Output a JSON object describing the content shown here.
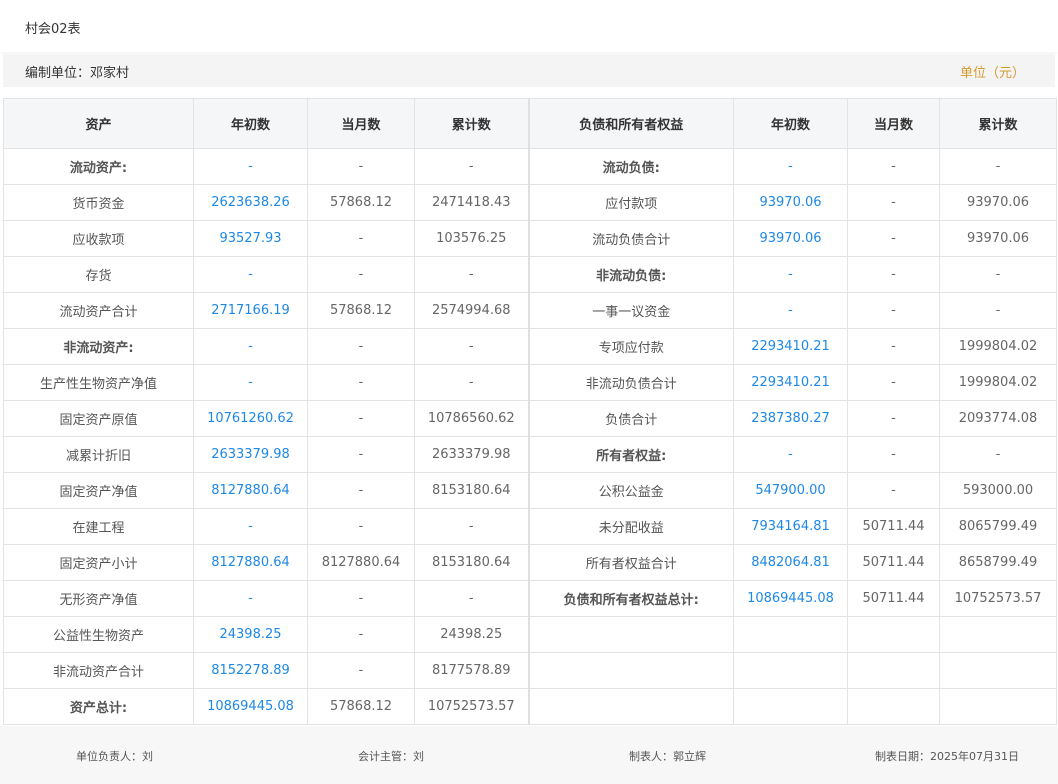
{
  "header": {
    "form_code": "村会02表",
    "compile_unit": "编制单位：邓家村",
    "currency_unit": "单位（元）"
  },
  "columns": {
    "assets": "资产",
    "assets_begin": "年初数",
    "assets_month": "当月数",
    "assets_cumulative": "累计数",
    "liabilities": "负债和所有者权益",
    "liab_begin": "年初数",
    "liab_month": "当月数",
    "liab_cumulative": "累计数"
  },
  "rows": [
    {
      "a": "流动资产:",
      "ab": "-",
      "am": "-",
      "ac": "-",
      "l": "流动负债:",
      "lb": "-",
      "lm": "-",
      "lc": "-"
    },
    {
      "a": "货币资金",
      "ab": "2623638.26",
      "am": "57868.12",
      "ac": "2471418.43",
      "l": "应付款项",
      "lb": "93970.06",
      "lm": "-",
      "lc": "93970.06"
    },
    {
      "a": "应收款项",
      "ab": "93527.93",
      "am": "-",
      "ac": "103576.25",
      "l": "流动负债合计",
      "lb": "93970.06",
      "lm": "-",
      "lc": "93970.06"
    },
    {
      "a": "存货",
      "ab": "-",
      "am": "-",
      "ac": "-",
      "l": "非流动负债:",
      "lb": "-",
      "lm": "-",
      "lc": "-"
    },
    {
      "a": "流动资产合计",
      "ab": "2717166.19",
      "am": "57868.12",
      "ac": "2574994.68",
      "l": "一事一议资金",
      "lb": "-",
      "lm": "-",
      "lc": "-"
    },
    {
      "a": "非流动资产:",
      "ab": "-",
      "am": "-",
      "ac": "-",
      "l": "专项应付款",
      "lb": "2293410.21",
      "lm": "-",
      "lc": "1999804.02"
    },
    {
      "a": "生产性生物资产净值",
      "ab": "-",
      "am": "-",
      "ac": "-",
      "l": "非流动负债合计",
      "lb": "2293410.21",
      "lm": "-",
      "lc": "1999804.02"
    },
    {
      "a": "固定资产原值",
      "ab": "10761260.62",
      "am": "-",
      "ac": "10786560.62",
      "l": "负债合计",
      "lb": "2387380.27",
      "lm": "-",
      "lc": "2093774.08"
    },
    {
      "a": "减累计折旧",
      "ab": "2633379.98",
      "am": "-",
      "ac": "2633379.98",
      "l": "所有者权益:",
      "lb": "-",
      "lm": "-",
      "lc": "-"
    },
    {
      "a": "固定资产净值",
      "ab": "8127880.64",
      "am": "-",
      "ac": "8153180.64",
      "l": "公积公益金",
      "lb": "547900.00",
      "lm": "-",
      "lc": "593000.00"
    },
    {
      "a": "在建工程",
      "ab": "-",
      "am": "-",
      "ac": "-",
      "l": "未分配收益",
      "lb": "7934164.81",
      "lm": "50711.44",
      "lc": "8065799.49"
    },
    {
      "a": "固定资产小计",
      "ab": "8127880.64",
      "am": "8127880.64",
      "ac": "8153180.64",
      "l": "所有者权益合计",
      "lb": "8482064.81",
      "lm": "50711.44",
      "lc": "8658799.49"
    },
    {
      "a": "无形资产净值",
      "ab": "-",
      "am": "-",
      "ac": "-",
      "l": "负债和所有者权益总计:",
      "lb": "10869445.08",
      "lm": "50711.44",
      "lc": "10752573.57"
    },
    {
      "a": "公益性生物资产",
      "ab": "24398.25",
      "am": "-",
      "ac": "24398.25",
      "l": "",
      "lb": "",
      "lm": "",
      "lc": ""
    },
    {
      "a": "非流动资产合计",
      "ab": "8152278.89",
      "am": "-",
      "ac": "8177578.89",
      "l": "",
      "lb": "",
      "lm": "",
      "lc": ""
    },
    {
      "a": "资产总计:",
      "ab": "10869445.08",
      "am": "57868.12",
      "ac": "10752573.57",
      "l": "",
      "lb": "",
      "lm": "",
      "lc": ""
    }
  ],
  "footer": {
    "unit_head": "单位负责人：刘",
    "accountant": "会计主管：刘",
    "preparer": "制表人：郭立辉",
    "date": "制表日期：2025年07月31日"
  },
  "colors": {
    "link_blue": "#1e88e5",
    "unit_gold": "#d49b2e"
  }
}
